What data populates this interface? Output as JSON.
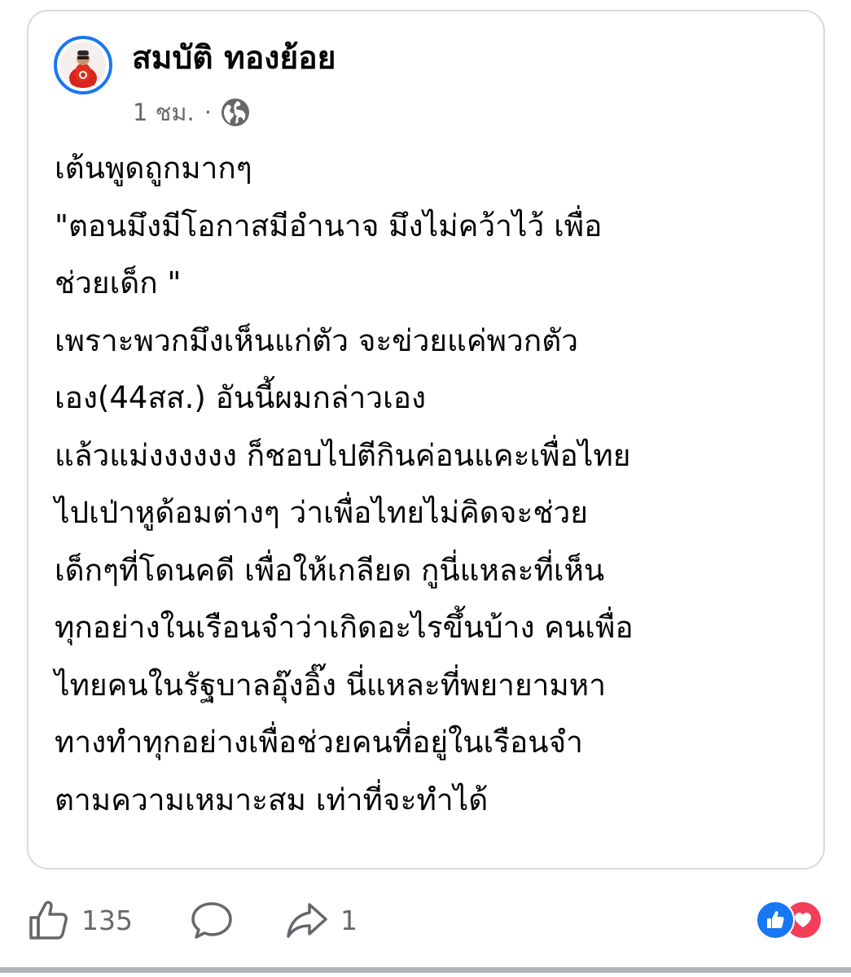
{
  "post": {
    "author": "สมบัติ ทองย้อย",
    "time": "1 ชม.",
    "separator": "·",
    "audience_icon": "globe-icon",
    "lines": [
      "เต้นพูดถูกมากๆ",
      "\"ตอนมึงมีโอกาสมีอำนาจ มึงไม่คว้าไว้ เพื่อ",
      "ช่วยเด็ก \"",
      "เพราะพวกมึงเห็นแก่ตัว จะข่วยแค่พวกตัว",
      "เอง(44สส.) อันนี้ผมกล่าวเอง",
      "แล้วแม่งงงงงง ก็ชอบไปตีกินค่อนแคะเพื่อไทย",
      "ไปเป่าหูด้อมต่างๆ ว่าเพื่อไทยไม่คิดจะช่วย",
      "เด็กๆที่โดนคดี เพื่อให้เกลียด กูนี่แหละที่เห็น",
      "ทุกอย่างในเรือนจำว่าเกิดอะไรขึ้นบ้าง คนเพื่อ",
      "ไทยคนในรัฐบาลอุ๊งอิ๊ง นี่แหละที่พยายามหา",
      "ทางทำทุกอย่างเพื่อช่วยคนที่อยู่ในเรือนจำ",
      "ตามความเหมาะสม เท่าที่จะทำได้"
    ]
  },
  "actions": {
    "like_icon": "thumbs-up-icon",
    "like_count": "135",
    "comment_icon": "comment-icon",
    "share_icon": "share-icon",
    "share_count": "1"
  },
  "reactions": {
    "like_color": "#1877f2",
    "love_color": "#f33e58"
  },
  "colors": {
    "accent": "#1877f2",
    "text": "#050505",
    "secondary_text": "#65676b",
    "card_border": "#d8d9dc"
  }
}
